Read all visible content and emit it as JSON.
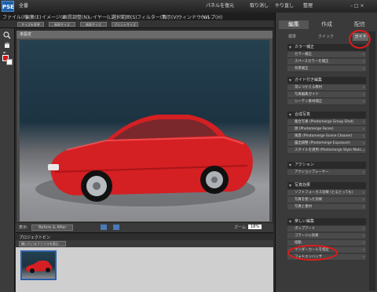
{
  "titlebar": {
    "logo": "PSE",
    "mode": "全番",
    "actions": [
      "パネルを復元",
      "取り消し",
      "やり直し",
      "整理"
    ]
  },
  "menubar": [
    "ファイル(F)",
    "編集(E)",
    "イメージ(I)",
    "画質調整(N)",
    "レイヤー(L)",
    "選択範囲(S)",
    "フィルター(T)",
    "表示(V)",
    "ウィンドウ(W)",
    "ヘルプ(H)"
  ],
  "options": [
    "サイズを変更",
    "画面サイズ",
    "画面サイズ",
    "プリントサイズ"
  ],
  "document": {
    "title": "未設定"
  },
  "statusbar": {
    "view": "表示:",
    "view_value": "Before & After",
    "zoom_label": "ズーム:",
    "zoom_value": "18%"
  },
  "bin": {
    "header": "プロジェクトビン",
    "dropdown": "開いているファイルを表示"
  },
  "sidebar": {
    "tabs": [
      "編集",
      "作成",
      "配信"
    ],
    "subtabs": [
      "標準",
      "クイック",
      "ガイド"
    ],
    "panels": [
      {
        "title": "カラー補正",
        "items": [
          "カラー補正",
          "スペースカラーを補正",
          "背景補正"
        ]
      },
      {
        "title": "ガイド付き編集",
        "items": [
          "常につかえる教材",
          "写真編集ガイド",
          "シーテン素材補正"
        ]
      },
      {
        "title": "合成写真",
        "items": [
          "集合写真 (Photomerge Group Shot)",
          "顔 (Photomerge Faces)",
          "風景 (Photomerge Scene Cleaner)",
          "露出調整 (Photomerge Exposure)",
          "スタイルを適用 (Photomerge Style Matc..."
        ]
      },
      {
        "title": "アクション",
        "items": [
          "アクションプレーヤー"
        ]
      },
      {
        "title": "写真効果",
        "items": [
          "ソフトフォーカス効果 (とるとっても)",
          "写真を使った効果",
          "写真と素材"
        ]
      },
      {
        "title": "楽しい編集",
        "items": [
          "ポップアート",
          "コラージュ効果",
          "指動",
          "サンダーカールを指定",
          "フォトエンハンサ"
        ]
      }
    ]
  }
}
